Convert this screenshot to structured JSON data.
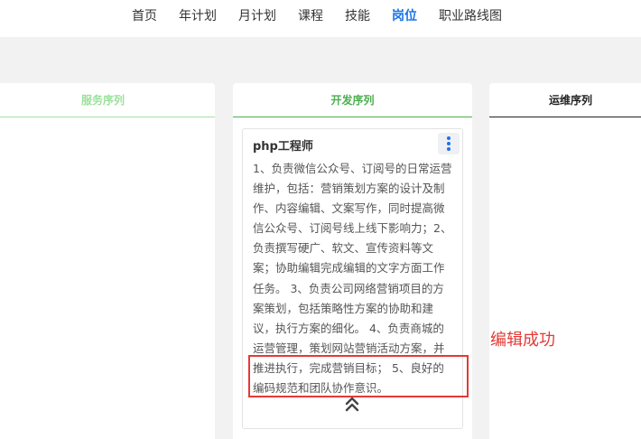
{
  "nav": {
    "items": [
      {
        "label": "首页"
      },
      {
        "label": "年计划"
      },
      {
        "label": "月计划"
      },
      {
        "label": "课程"
      },
      {
        "label": "技能"
      },
      {
        "label": "岗位",
        "active": true
      },
      {
        "label": "职业路线图"
      }
    ]
  },
  "columns": [
    {
      "title": "服务序列",
      "color": "#9be09b"
    },
    {
      "title": "开发序列",
      "color": "#4caf50"
    },
    {
      "title": "运维序列",
      "color": "#222222"
    }
  ],
  "card": {
    "title": "php工程师",
    "body": "1、负责微信公众号、订阅号的日常运营维护，包括：营销策划方案的设计及制作、内容编辑、文案写作，同时提高微信公众号、订阅号线上线下影响力；2、负责撰写硬广、软文、宣传资料等文案；协助编辑完成编辑的文字方面工作任务。 3、负责公司网络营销项目的方案策划，包括策略性方案的协助和建议，执行方案的细化。 4、负责商城的运营管理，策划网站营销活动方案，并推进执行，完成营销目标； 5、良好的编码规范和团队协作意识。",
    "more_icon": "more-vertical-icon",
    "collapse_icon": "double-chevron-up-icon"
  },
  "annotation": {
    "text": "编辑成功",
    "color": "#e53935"
  },
  "colors": {
    "accent": "#1a73e8",
    "background": "#f2f2f2"
  }
}
